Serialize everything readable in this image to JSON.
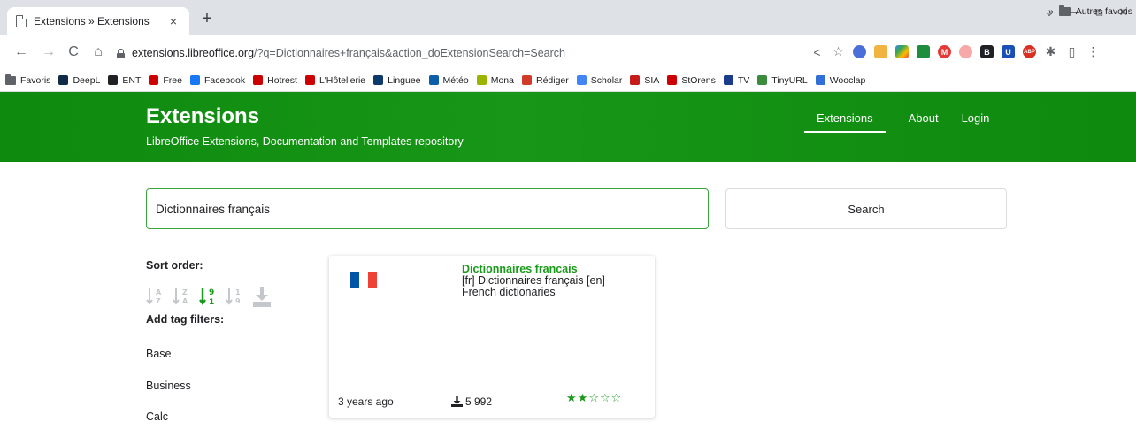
{
  "browser": {
    "tab_title": "Extensions » Extensions",
    "tab_close": "×",
    "new_tab": "+",
    "window_controls": [
      "⌄",
      "—",
      "⧉",
      "✕"
    ],
    "url_host": "extensions.libreoffice.org",
    "url_rest": "/?q=Dictionnaires+français&action_doExtensionSearch=Search",
    "nav": {
      "back": "←",
      "forward": "→",
      "reload": "C",
      "home": "⌂"
    },
    "toolbar_icons": [
      "share-icon",
      "star-icon",
      "extension-icons",
      "puzzle-icon",
      "sidepanel-icon",
      "menu-icon"
    ]
  },
  "bookmarks": {
    "items": [
      {
        "label": "Favoris",
        "icon": "folder-icon",
        "color": "#5f6368"
      },
      {
        "label": "DeepL",
        "icon": "deepl-icon",
        "color": "#0f2b46"
      },
      {
        "label": "ENT",
        "icon": "lock-icon",
        "color": "#202124"
      },
      {
        "label": "Free",
        "icon": "free-icon",
        "color": "#cc0000"
      },
      {
        "label": "Facebook",
        "icon": "facebook-icon",
        "color": "#1877f2"
      },
      {
        "label": "Hotrest",
        "icon": "hotrest-icon",
        "color": "#cc0000"
      },
      {
        "label": "L'Hôtellerie",
        "icon": "hotellerie-icon",
        "color": "#cc0000"
      },
      {
        "label": "Linguee",
        "icon": "linguee-icon",
        "color": "#0d3a6a"
      },
      {
        "label": "Météo",
        "icon": "meteo-icon",
        "color": "#0a5fa8"
      },
      {
        "label": "Mona",
        "icon": "mona-icon",
        "color": "#9bb400"
      },
      {
        "label": "Rédiger",
        "icon": "rediger-icon",
        "color": "#d13b2a"
      },
      {
        "label": "Scholar",
        "icon": "scholar-icon",
        "color": "#4285f4"
      },
      {
        "label": "SIA",
        "icon": "sia-icon",
        "color": "#c61b1b"
      },
      {
        "label": "StOrens",
        "icon": "storens-icon",
        "color": "#cc0000"
      },
      {
        "label": "TV",
        "icon": "tv-icon",
        "color": "#1b3c8a"
      },
      {
        "label": "TinyURL",
        "icon": "tinyurl-icon",
        "color": "#3c8a3c"
      },
      {
        "label": "Wooclap",
        "icon": "wooclap-icon",
        "color": "#2f6fd6"
      }
    ],
    "more": "»",
    "other_folder": "Autres favoris"
  },
  "header": {
    "title": "Extensions",
    "subtitle": "LibreOffice Extensions, Documentation and Templates repository",
    "nav": [
      "Extensions",
      "About",
      "Login"
    ],
    "accent": "#138f13"
  },
  "search": {
    "value": "Dictionnaires français",
    "placeholder": "",
    "button": "Search"
  },
  "sidebar": {
    "sort_label": "Sort order:",
    "sort_options": [
      "sort-alpha-asc-icon",
      "sort-alpha-desc-icon",
      "sort-numeric-desc-icon",
      "sort-numeric-asc-icon",
      "sort-downloads-icon"
    ],
    "active_sort": "sort-numeric-desc-icon",
    "tag_label": "Add tag filters:",
    "tags": [
      "Base",
      "Business",
      "Calc"
    ]
  },
  "results": [
    {
      "title": "Dictionnaires francais",
      "description": "[fr] Dictionnaires français [en] French dictionaries",
      "flag": [
        "#0055a4",
        "#ffffff",
        "#ef4135"
      ],
      "age": "3 years ago",
      "downloads": "5 992",
      "rating": 2,
      "rating_max": 5
    }
  ]
}
